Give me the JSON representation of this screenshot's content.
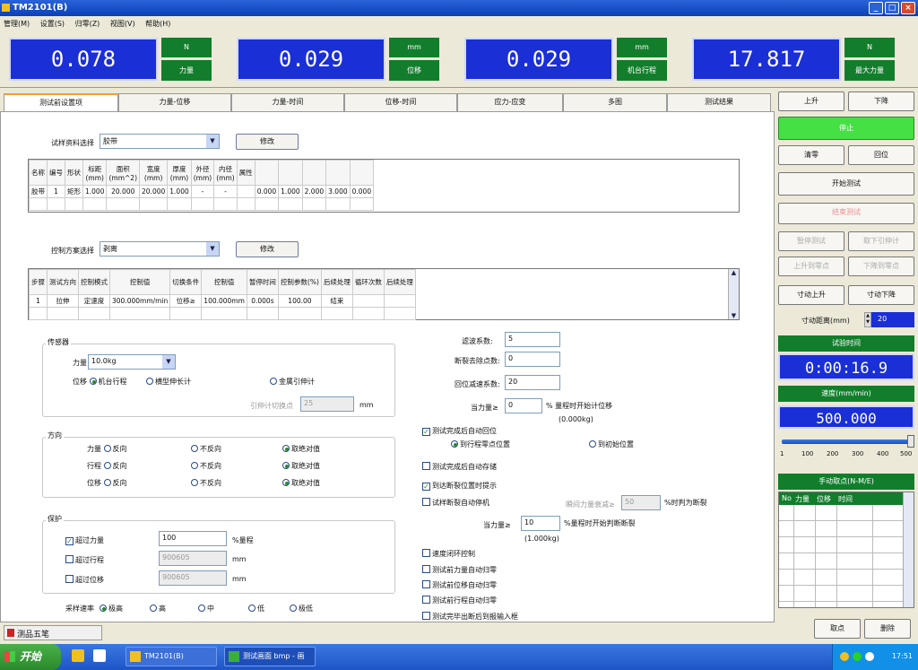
{
  "window": {
    "title": "TM2101(B)"
  },
  "menu": [
    "管理(M)",
    "设置(S)",
    "归零(Z)",
    "视图(V)",
    "帮助(H)"
  ],
  "meters": [
    {
      "value": "0.078",
      "unit": "N",
      "name": "力量"
    },
    {
      "value": "0.029",
      "unit": "mm",
      "name": "位移"
    },
    {
      "value": "0.029",
      "unit": "mm",
      "name": "机台行程"
    },
    {
      "value": "17.817",
      "unit": "N",
      "name": "最大力量"
    }
  ],
  "tabs": [
    "测试前设置项",
    "力量-位移",
    "力量-时间",
    "位移-时间",
    "应力-应变",
    "多图",
    "测试结果"
  ],
  "material": {
    "label": "试样资料选择",
    "value": "胶带",
    "modify": "修改",
    "headers": [
      "名称",
      "编号",
      "形状",
      "标距\n(mm)",
      "面积\n(mm^2)",
      "宽度\n(mm)",
      "厚度\n(mm)",
      "外径\n(mm)",
      "内径\n(mm)",
      "属性",
      "",
      "",
      "",
      "",
      ""
    ],
    "row": [
      "胶带",
      "1",
      "矩形",
      "1.000",
      "20.000",
      "20.000",
      "1.000",
      "-",
      "-",
      "",
      "0.000",
      "1.000",
      "2.000",
      "3.000",
      "0.000"
    ]
  },
  "control": {
    "label": "控制方案选择",
    "value": "剥离",
    "modify": "修改",
    "headers": [
      "步骤",
      "测试方向",
      "控制模式",
      "控制值",
      "切换条件",
      "控制值",
      "暂停时间",
      "控制参数(%)",
      "后续处理",
      "循环次数",
      "后续处理"
    ],
    "row": [
      "1",
      "拉伸",
      "定速度",
      "300.000mm/min",
      "位移≥",
      "100.000mm",
      "0.000s",
      "100.00",
      "结束",
      "",
      ""
    ]
  },
  "sensor": {
    "title": "传感器",
    "force_label": "力量",
    "force_value": "10.0kg",
    "disp_label": "位移",
    "opt_machine": "机台行程",
    "opt_ext": "横型伸长计",
    "opt_metal": "金属引伸计",
    "switch_label": "引伸计切换点",
    "switch_value": "25",
    "switch_unit": "mm"
  },
  "direction": {
    "title": "方向",
    "rows": [
      {
        "label": "力量",
        "a": "反向",
        "b": "不反向",
        "c": "取绝对值"
      },
      {
        "label": "行程",
        "a": "反向",
        "b": "不反向",
        "c": "取绝对值"
      },
      {
        "label": "位移",
        "a": "反向",
        "b": "不反向",
        "c": "取绝对值"
      }
    ]
  },
  "protect": {
    "title": "保护",
    "force_label": "超过力量",
    "force_value": "100",
    "force_unit": "%量程",
    "stroke_label": "超过行程",
    "stroke_value": "900605",
    "stroke_unit": "mm",
    "disp_label": "超过位移",
    "disp_value": "900605",
    "disp_unit": "mm"
  },
  "sampling": {
    "label": "采样速率",
    "options": [
      "极高",
      "高",
      "中",
      "低",
      "极低"
    ]
  },
  "params": {
    "filter_label": "滤波系数:",
    "filter_value": "5",
    "break_label": "断裂去除点数:",
    "break_value": "0",
    "return_label": "回位减速系数:",
    "return_value": "20",
    "force_label": "当力量≥",
    "force_value": "0",
    "force_note": "% 量程时开始计位移",
    "force_sub": "(0.000kg)"
  },
  "options": {
    "auto_return": "测试完成后自动回位",
    "ret_a": "到行程零点位置",
    "ret_b": "到初始位置",
    "auto_save": "测试完成后自动存储",
    "break_prompt": "到达断裂位置时提示",
    "break_stop": "试样断裂自动停机",
    "drop_label": "瞬间力量衰减≥",
    "drop_value": "50",
    "drop_note": "%时判为断裂",
    "f2_label": "当力量≥",
    "f2_value": "10",
    "f2_note": "%量程时开始判断断裂",
    "f2_sub": "(1.000kg)",
    "speed_loop": "速度闭环控制",
    "zero_force": "测试前力量自动归零",
    "zero_disp": "测试前位移自动归零",
    "zero_stroke": "测试前行程自动归零",
    "output_report": "测试完毕出断后到报输入框"
  },
  "right": {
    "up": "上升",
    "down": "下降",
    "stop": "停止",
    "clear": "清零",
    "return": "回位",
    "start": "开始测试",
    "end": "结束测试",
    "pause": "暂停测试",
    "remove_ext": "取下引伸计",
    "up_zero": "上升到零点",
    "down_zero": "下降到零点",
    "jog_up": "寸动上升",
    "jog_down": "寸动下降",
    "jog_dist_label": "寸动距离(mm)",
    "jog_dist": "20",
    "time_label": "试验时间",
    "time_value": "0:00:16.9",
    "speed_label": "速度(mm/min)",
    "speed_value": "500.000",
    "slider_ticks": [
      "1",
      "100",
      "200",
      "300",
      "400",
      "500"
    ],
    "pick_label": "手动取点(N-M/E)",
    "pick_headers": [
      "No",
      "力量",
      "位移",
      "时间"
    ],
    "pick": "取点",
    "delete": "删除"
  },
  "status_tab": "测品五笔",
  "taskbar": {
    "start": "开始",
    "items": [
      "TM2101(B)",
      "测试画面 bmp - 画"
    ],
    "clock": "17:51"
  }
}
